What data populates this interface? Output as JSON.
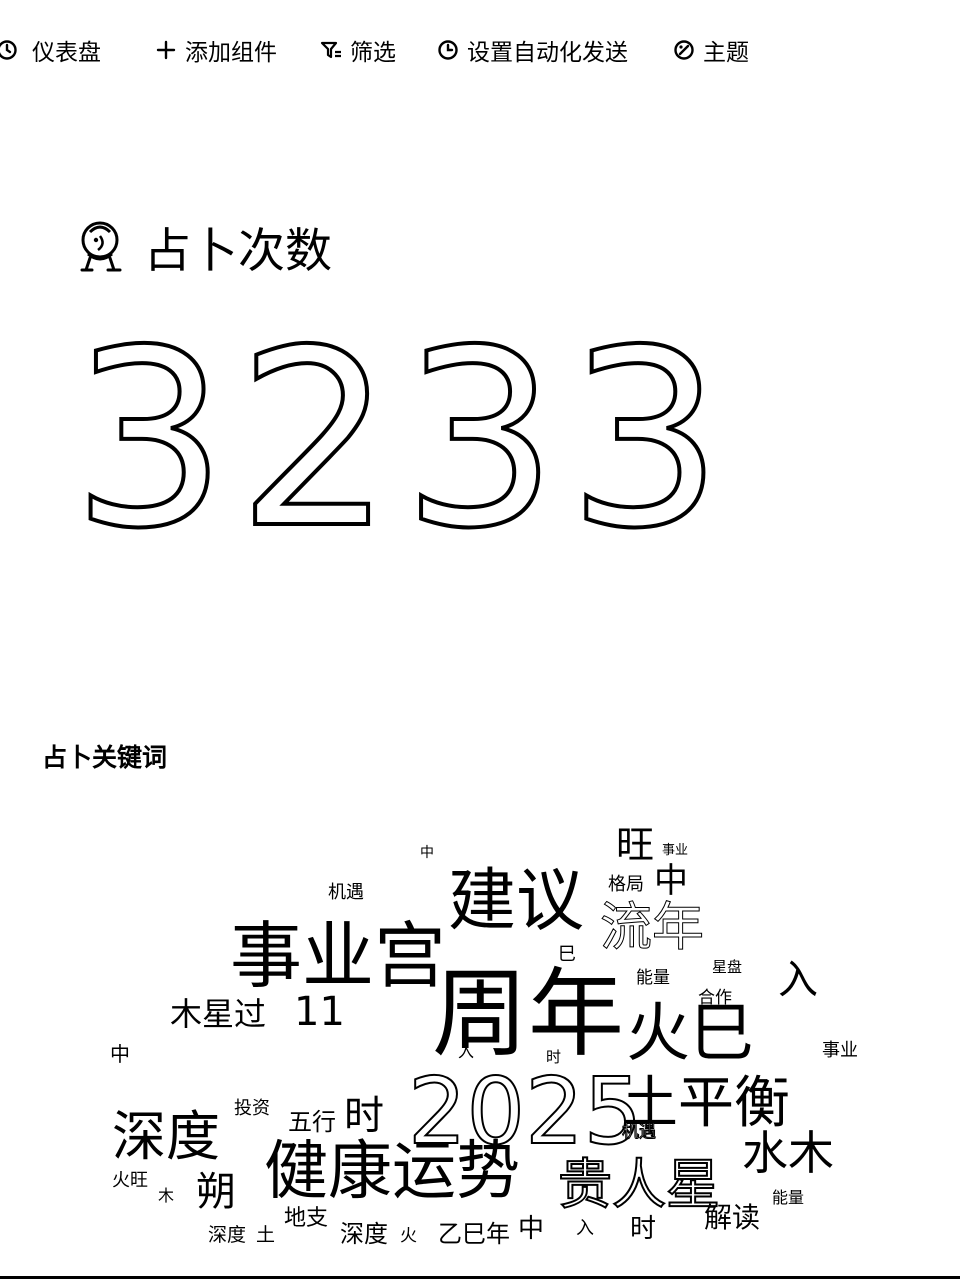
{
  "toolbar": {
    "dashboard_label": "仪表盘",
    "add_widget_label": "添加组件",
    "filter_label": "筛选",
    "automation_label": "设置自动化发送",
    "theme_label": "主题"
  },
  "metric": {
    "title": "占卜次数",
    "value": "3233"
  },
  "wordcloud": {
    "title": "占卜关键词",
    "words": [
      {
        "text": "周年",
        "size": 96
      },
      {
        "text": "2025",
        "size": 92
      },
      {
        "text": "事业宫",
        "size": 72
      },
      {
        "text": "建议",
        "size": 68
      },
      {
        "text": "健康运势",
        "size": 64
      },
      {
        "text": "火巳",
        "size": 64
      },
      {
        "text": "土平衡",
        "size": 56
      },
      {
        "text": "深度",
        "size": 54
      },
      {
        "text": "贵人星",
        "size": 54
      },
      {
        "text": "流年",
        "size": 52
      },
      {
        "text": "水木",
        "size": 46
      },
      {
        "text": "木星过",
        "size": 32
      },
      {
        "text": "11",
        "size": 40
      },
      {
        "text": "时",
        "size": 40
      },
      {
        "text": "朔",
        "size": 40
      },
      {
        "text": "入",
        "size": 40
      },
      {
        "text": "旺",
        "size": 38
      },
      {
        "text": "中",
        "size": 34
      },
      {
        "text": "五行",
        "size": 24
      },
      {
        "text": "解读",
        "size": 28
      },
      {
        "text": "乙巳年",
        "size": 24
      },
      {
        "text": "深度",
        "size": 24
      },
      {
        "text": "投资",
        "size": 18
      },
      {
        "text": "机遇",
        "size": 18
      },
      {
        "text": "格局",
        "size": 18
      },
      {
        "text": "能量",
        "size": 17
      },
      {
        "text": "合作",
        "size": 17
      },
      {
        "text": "事业",
        "size": 18
      },
      {
        "text": "星盘",
        "size": 15
      },
      {
        "text": "火旺",
        "size": 18
      },
      {
        "text": "地支",
        "size": 22
      },
      {
        "text": "深度",
        "size": 19
      },
      {
        "text": "土",
        "size": 19
      },
      {
        "text": "火",
        "size": 17
      },
      {
        "text": "中",
        "size": 26
      },
      {
        "text": "时",
        "size": 26
      },
      {
        "text": "入",
        "size": 18
      },
      {
        "text": "机遇",
        "size": 17
      },
      {
        "text": "中",
        "size": 20
      },
      {
        "text": "巳",
        "size": 18
      },
      {
        "text": "事业",
        "size": 13
      },
      {
        "text": "木",
        "size": 16
      },
      {
        "text": "能量",
        "size": 16
      },
      {
        "text": "时",
        "size": 15
      },
      {
        "text": "入",
        "size": 16
      },
      {
        "text": "中",
        "size": 14
      }
    ]
  },
  "colors": {
    "background": "#ffffff",
    "text": "#000000"
  }
}
